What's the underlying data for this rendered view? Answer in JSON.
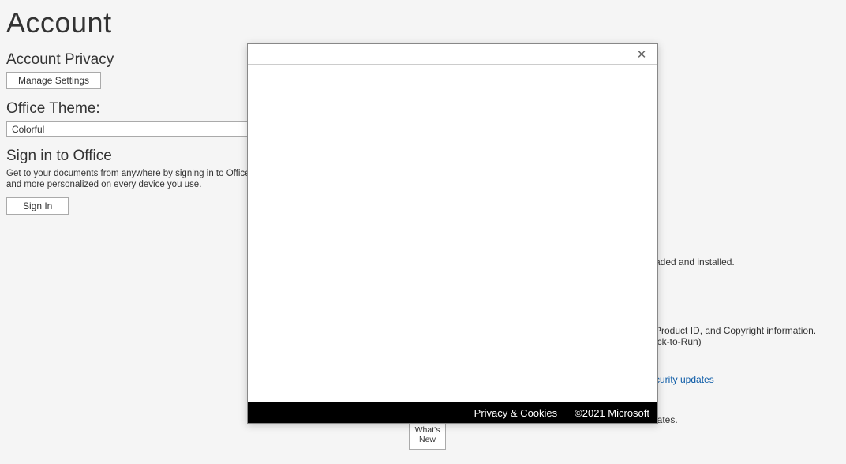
{
  "page_title": "Account",
  "privacy": {
    "heading": "Account Privacy",
    "manage_label": "Manage Settings"
  },
  "theme": {
    "heading": "Office Theme:",
    "value": "Colorful"
  },
  "signin": {
    "heading": "Sign in to Office",
    "desc": "Get to your documents from anywhere by signing in to Office. Your experience just gets better and more personalized on every device you use.",
    "button": "Sign In"
  },
  "right": {
    "updates_suffix": "aded and installed.",
    "about_line1_suffix": "Product ID, and Copyright information.",
    "about_line2_suffix": "ick-to-Run)",
    "link_suffix": "curity updates",
    "lates_suffix": "lates."
  },
  "whatsnew": {
    "line1": "What's",
    "line2": "New"
  },
  "modal": {
    "footer_privacy": "Privacy & Cookies",
    "footer_copyright": "©2021 Microsoft"
  }
}
